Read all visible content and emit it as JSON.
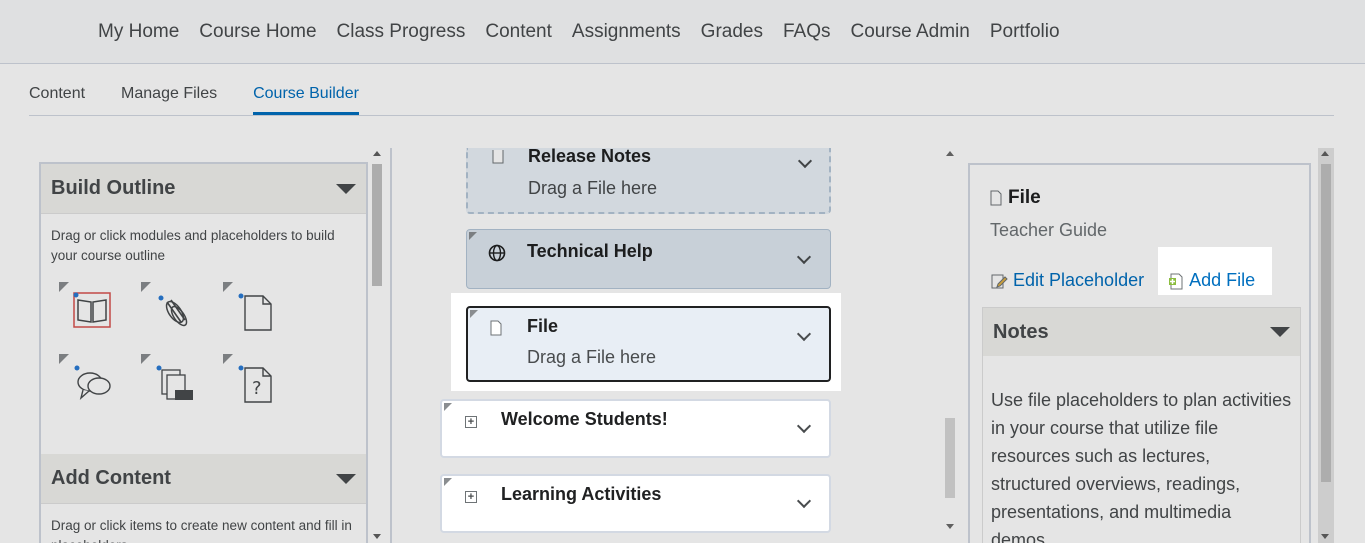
{
  "nav": {
    "items": [
      "My Home",
      "Course Home",
      "Class Progress",
      "Content",
      "Assignments",
      "Grades",
      "FAQs",
      "Course Admin",
      "Portfolio"
    ]
  },
  "subtabs": {
    "items": [
      "Content",
      "Manage Files",
      "Course Builder"
    ],
    "active": "Course Builder"
  },
  "build_outline": {
    "title": "Build Outline",
    "description": "Drag or click modules and placeholders to build your course outline",
    "icons": [
      "module-book-icon",
      "link-placeholder-icon",
      "file-placeholder-icon",
      "discussion-placeholder-icon",
      "files-placeholder-icon",
      "quiz-placeholder-icon"
    ]
  },
  "add_content": {
    "title": "Add Content",
    "description": "Drag or click items to create new content and fill in placeholders"
  },
  "outline": {
    "release_notes": {
      "title": "Release Notes",
      "sub": "Drag a File here"
    },
    "technical_help": {
      "title": "Technical Help"
    },
    "file": {
      "title": "File",
      "sub": "Drag a File here"
    },
    "welcome": {
      "title": "Welcome Students!"
    },
    "learning": {
      "title": "Learning Activities"
    }
  },
  "details": {
    "type_label": "File",
    "subtitle": "Teacher Guide",
    "edit_label": "Edit Placeholder",
    "add_label": "Add File",
    "notes_title": "Notes",
    "notes_text": "Use file placeholders to plan activities in your course that utilize file resources such as lectures, structured overviews, readings, presentations, and multimedia demos."
  },
  "colors": {
    "accent": "#006fbf",
    "text": "#494c4e",
    "border": "#d3d9e3",
    "selected_bg": "#e8eef5"
  }
}
